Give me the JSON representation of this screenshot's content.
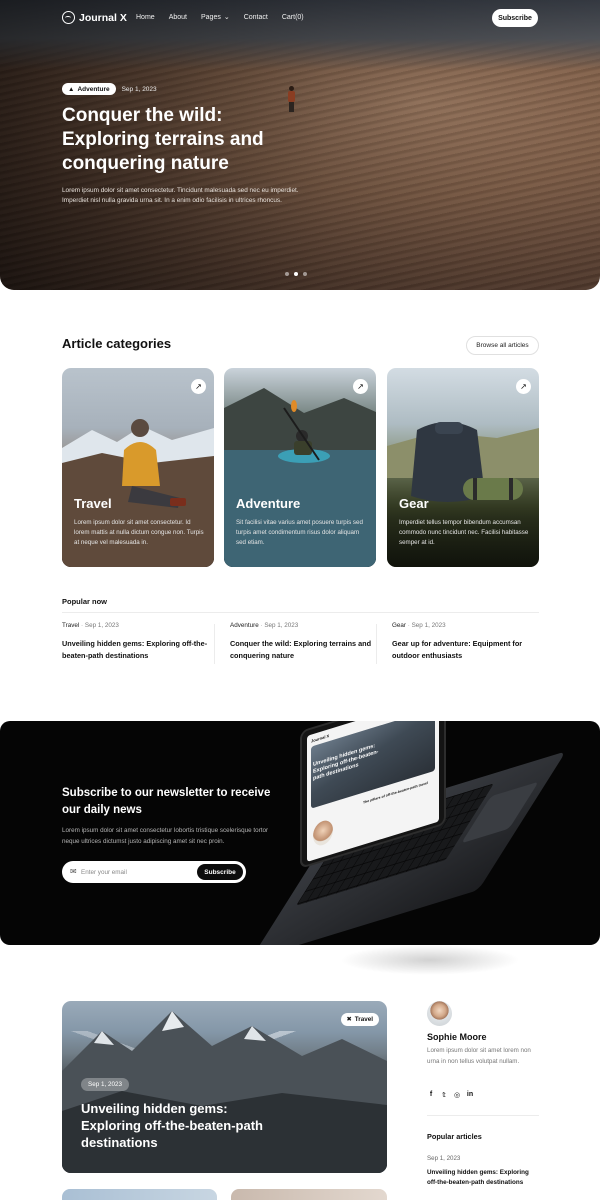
{
  "nav": {
    "logo": "Journal X",
    "links": [
      "Home",
      "About",
      "Pages",
      "Contact",
      "Cart(0)"
    ],
    "subscribe": "Subscribe"
  },
  "hero": {
    "badge": "Adventure",
    "date": "Sep 1, 2023",
    "title": "Conquer the wild: Exploring terrains and conquering nature",
    "description": "Lorem ipsum dolor sit amet consectetur. Tincidunt malesuada sed nec eu imperdiet. Imperdiet nisl nulla gravida urna sit. In a enim odio facilisis in ultrices rhoncus.",
    "active_slide": 2,
    "slides": 3
  },
  "categories": {
    "title": "Article categories",
    "browse": "Browse all articles",
    "items": [
      {
        "name": "Travel",
        "description": "Lorem ipsum dolor sit amet consectetur. Id lorem mattis at nulla dictum congue non. Turpis at neque vel malesuada in."
      },
      {
        "name": "Adventure",
        "description": "Sit facilisi vitae varius amet posuere turpis sed turpis amet condimentum risus dolor aliquam sed etiam."
      },
      {
        "name": "Gear",
        "description": "Imperdiet tellus tempor bibendum accumsan commodo nunc tincidunt nec. Facilisi habitasse semper at id."
      }
    ]
  },
  "popular": {
    "label": "Popular now",
    "items": [
      {
        "category": "Travel",
        "date": "Sep 1, 2023",
        "title": "Unveiling hidden gems: Exploring off-the-beaten-path destinations"
      },
      {
        "category": "Adventure",
        "date": "Sep 1, 2023",
        "title": "Conquer the wild: Exploring terrains and conquering nature"
      },
      {
        "category": "Gear",
        "date": "Sep 1, 2023",
        "title": "Gear up for adventure: Equipment for outdoor enthusiasts"
      }
    ]
  },
  "newsletter": {
    "title": "Subscribe to our newsletter to receive our daily news",
    "description": "Lorem ipsum dolor sit amet consectetur lobortis tristique scelerisque tortor neque ultrices dictumst justo adipiscing amet sit nec proin.",
    "placeholder": "Enter your email",
    "button": "Subscribe",
    "laptop": {
      "logo": "Journal X",
      "hero_title": "Unveiling hidden gems: Exploring off-the-beaten-path destinations",
      "subtitle": "The pillars of off-the-beaten-path travel"
    }
  },
  "featured": {
    "badge": "Travel",
    "date": "Sep 1, 2023",
    "title": "Unveiling hidden gems: Exploring off-the-beaten-path destinations"
  },
  "author": {
    "name": "Sophie Moore",
    "bio": "Lorem ipsum dolor sit amet lorem non urna in non tellus volutpat nullam.",
    "socials": [
      "facebook-icon",
      "twitter-icon",
      "instagram-icon",
      "linkedin-icon"
    ]
  },
  "sidebar": {
    "title": "Popular articles",
    "date": "Sep 1, 2023",
    "article": "Unveiling hidden gems: Exploring off-the-beaten-path destinations"
  }
}
